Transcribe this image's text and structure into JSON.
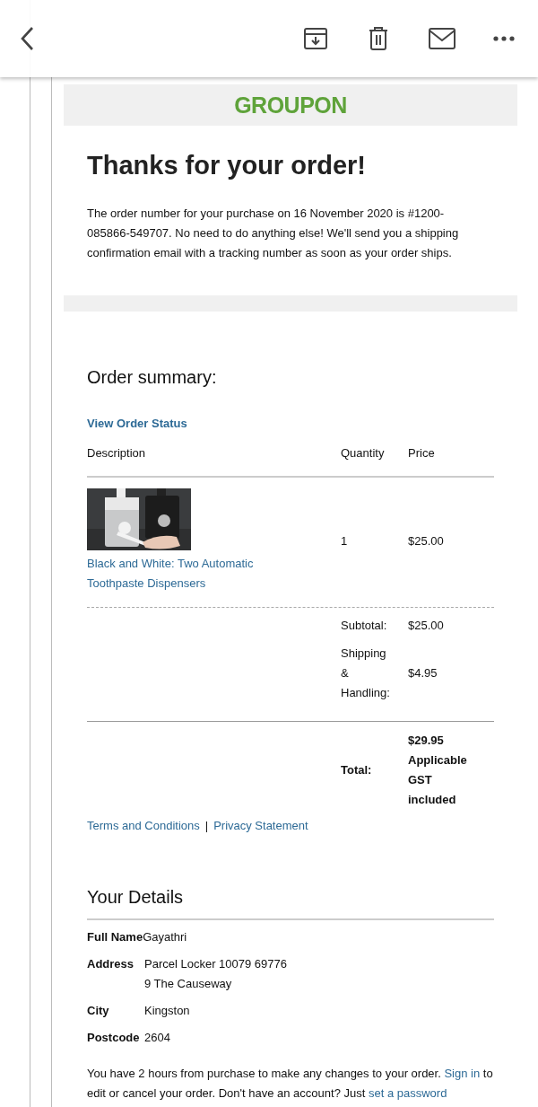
{
  "footer_separator": "|",
  "brand": "GROUPON",
  "title": "Thanks for your order!",
  "intro": "The order number for your purchase on 16 November 2020 is #1200-085866-549707. No need to do anything else! We'll send you a shipping confirmation email with a tracking number as soon as your order ships.",
  "summary": {
    "heading": "Order summary:",
    "status_link": "View Order Status",
    "columns": [
      "Description",
      "Quantity",
      "Price"
    ],
    "items": [
      {
        "kind": "picture",
        "name": "Black and White: Two Automatic Toothpaste Dispensers",
        "quantity": "1",
        "price": "$25.00"
      }
    ],
    "totals": [
      {
        "label": "Subtotal:",
        "value": "$25.00",
        "bold": false,
        "rule": false
      },
      {
        "label": "Shipping & Handling:",
        "value": "$4.95",
        "bold": false,
        "rule": false
      },
      {
        "label": "Total:",
        "value": "$29.95 Applicable GST included",
        "bold": true,
        "rule": true
      }
    ]
  },
  "footer_links": [
    "Terms and Conditions",
    "Privacy Statement"
  ],
  "details": {
    "heading": "Your Details",
    "rows": [
      {
        "label": "Full Name",
        "lines": [
          "Gayathri"
        ],
        "tight": true
      },
      {
        "label": "Address",
        "lines": [
          "Parcel Locker 10079 69776",
          "9 The Causeway"
        ],
        "tight": false
      },
      {
        "label": "City",
        "lines": [
          "Kingston"
        ],
        "tight": false
      },
      {
        "label": "Postcode",
        "lines": [
          "2604"
        ],
        "tight": false
      }
    ]
  },
  "note": [
    {
      "text": "You have 2 hours from purchase to make any changes to your order. ",
      "link": false
    },
    {
      "text": "Sign in",
      "link": true
    },
    {
      "text": " to edit or cancel your order. Don't have an account? Just ",
      "link": false
    },
    {
      "text": "set a password",
      "link": true
    }
  ]
}
